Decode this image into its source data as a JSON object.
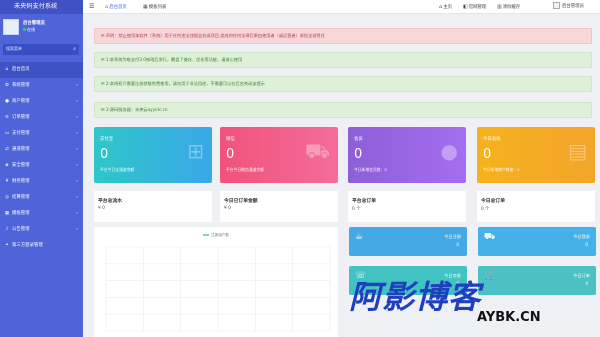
{
  "sidebar": {
    "title": "未央码支付系统",
    "user": {
      "name": "后台管理员",
      "status": "在线"
    },
    "search_placeholder": "搜索菜单",
    "items": [
      {
        "label": "后台首页",
        "icon": "home-icon",
        "expandable": false
      },
      {
        "label": "系统管理",
        "icon": "gear-icon",
        "expandable": true
      },
      {
        "label": "商户管理",
        "icon": "user-icon",
        "expandable": true
      },
      {
        "label": "订单管理",
        "icon": "list-icon",
        "expandable": true
      },
      {
        "label": "支付管理",
        "icon": "credit-card-icon",
        "expandable": true
      },
      {
        "label": "通道管理",
        "icon": "channel-icon",
        "expandable": true
      },
      {
        "label": "安全管理",
        "icon": "shield-icon",
        "expandable": true
      },
      {
        "label": "财务管理",
        "icon": "money-icon",
        "expandable": true
      },
      {
        "label": "结算管理",
        "icon": "settle-icon",
        "expandable": true
      },
      {
        "label": "模板管理",
        "icon": "template-icon",
        "expandable": true
      },
      {
        "label": "公告管理",
        "icon": "bell-icon",
        "expandable": true
      },
      {
        "label": "第三方登录管理",
        "icon": "link-icon",
        "expandable": false
      }
    ]
  },
  "topbar": {
    "menu_icon": "☰",
    "tabs": [
      {
        "label": "后台首页",
        "icon": "home-icon"
      },
      {
        "label": "模板列表",
        "icon": "template-icon"
      }
    ],
    "actions": [
      {
        "label": "主页",
        "icon": "home-icon"
      },
      {
        "label": "官网管理",
        "icon": "website-icon"
      },
      {
        "label": "清除缓存",
        "icon": "trash-icon"
      },
      {
        "label": "后台管理员",
        "icon": "avatar"
      }
    ]
  },
  "alerts": [
    {
      "type": "danger",
      "text": "声明：禁止使用本软件（系统）用于任何违法违规业务或项目,造成的任何法律后果由使用者（或运营者）承担全部责任"
    },
    {
      "type": "success",
      "text": "1:本系统为唯支付3.0修改后发行，覆盖了美化、优化等功能，请放心使用"
    },
    {
      "type": "success",
      "text": "2:本授权只需要注册就能免费使用，请勿用于非法用途，不需要可以在后台关闭该提示"
    },
    {
      "type": "success",
      "text": "3:源码服务器：未央云ayyidc.cn"
    }
  ],
  "stats": [
    {
      "title": "支付宝",
      "value": "0",
      "sub": "平台今日宝通道余额",
      "color_from": "#2ec7c9",
      "color_to": "#3aa7e8",
      "icon": "network-icon"
    },
    {
      "title": "微信",
      "value": "0",
      "sub": "平台今日微信通道余额",
      "color_from": "#f0527a",
      "color_to": "#f56c9b",
      "icon": "cart-icon"
    },
    {
      "title": "会员",
      "value": "0",
      "sub": "今日新增会员数：0",
      "color_from": "#8e5ed8",
      "color_to": "#a46ef0",
      "icon": "user-icon"
    },
    {
      "title": "今日总收",
      "value": "0",
      "sub": "今日新增商户数量：0",
      "color_from": "#f6b21d",
      "color_to": "#f2a52b",
      "icon": "document-icon"
    }
  ],
  "summary_cards": [
    {
      "title": "平台总流水",
      "value": "¥ 0"
    },
    {
      "title": "今日已订单金额",
      "value": "¥ 0"
    },
    {
      "title": "平台总订单",
      "value": "0 个"
    },
    {
      "title": "今日总订单",
      "value": "0 个"
    }
  ],
  "chart_data": {
    "type": "line",
    "series": [
      {
        "name": "注册用户数",
        "values": []
      }
    ],
    "grid": true,
    "legend": "top-center"
  },
  "tiles": [
    {
      "title": "今日注册",
      "value": "0",
      "icon": "cup-icon",
      "color": "#45a9e6"
    },
    {
      "title": "今日登录",
      "value": "0",
      "icon": "truck-icon",
      "color": "#44b2e8"
    },
    {
      "title": "今日交易",
      "value": "0",
      "icon": "phone-icon",
      "color": "#42c2c3"
    },
    {
      "title": "今日订单",
      "value": "0",
      "icon": "cart-icon",
      "color": "#4cc1c4"
    }
  ],
  "watermark": {
    "text": "阿影博客",
    "domain": "AYBK.CN"
  }
}
